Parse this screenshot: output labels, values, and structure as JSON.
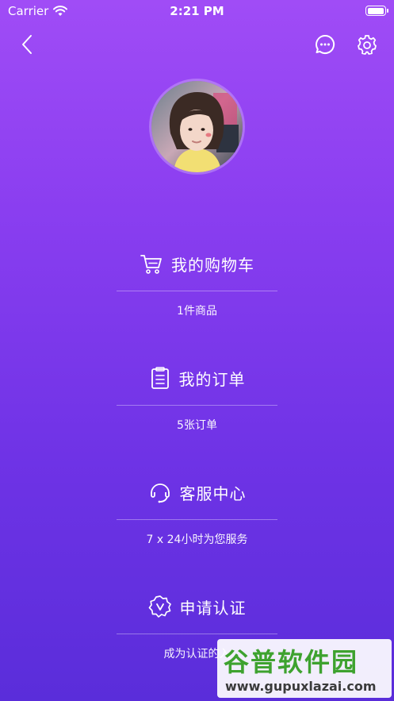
{
  "status_bar": {
    "carrier": "Carrier",
    "time": "2:21 PM",
    "battery_level": 1.0
  },
  "nav": {
    "back_icon": "chevron-left-icon",
    "message_icon": "chat-bubble-icon",
    "settings_icon": "gear-icon"
  },
  "profile": {
    "avatar_alt": "user avatar"
  },
  "menu": [
    {
      "title": "我的购物车",
      "subtitle": "1件商品",
      "icon": "cart-icon"
    },
    {
      "title": "我的订单",
      "subtitle": "5张订单",
      "icon": "clipboard-icon"
    },
    {
      "title": "客服中心",
      "subtitle": "7 x 24小时为您服务",
      "icon": "headset-icon"
    },
    {
      "title": "申请认证",
      "subtitle": "成为认证的入",
      "icon": "badge-check-icon"
    }
  ],
  "watermark": {
    "title": "谷普软件园",
    "url": "www.gupuxlazai.com"
  },
  "colors": {
    "gradient_top": "#a04cf6",
    "gradient_bottom": "#5a2dda",
    "watermark_green": "#3ea22f"
  }
}
